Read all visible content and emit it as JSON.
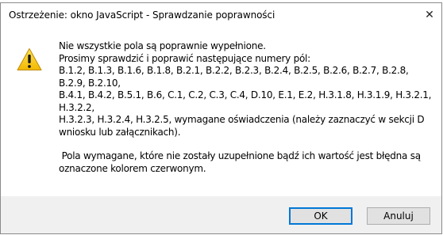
{
  "dialog": {
    "title": "Ostrzeżenie: okno JavaScript - Sprawdzanie poprawności",
    "close_glyph": "✕",
    "icon": "warning-icon",
    "message": {
      "line1": "Nie wszystkie pola są poprawnie wypełnione.",
      "line2": "Prosimy sprawdzić i poprawić następujące numery pól:",
      "line3": "B.1.2, B.1.3, B.1.6, B.1.8, B.2.1, B.2.2, B.2.3, B.2.4, B.2.5, B.2.6, B.2.7, B.2.8, B.2.9, B.2.10,",
      "line4": "B.4.1, B.4.2, B.5.1, B.6, C.1, C.2, C.3, C.4, D.10, E.1, E.2, H.3.1.8, H.3.1.9, H.3.2.1, H.3.2.2,",
      "line5": "H.3.2.3, H.3.2.4, H.3.2.5, wymagane oświadczenia (należy zaznaczyć w sekcji D",
      "line6": "wniosku lub załącznikach).",
      "line7": " Pola wymagane, które nie zostały uzupełnione bądź ich wartość jest błędna są",
      "line8": "oznaczone kolorem czerwonym."
    },
    "buttons": {
      "ok_label": "OK",
      "cancel_label": "Anuluj"
    },
    "colors": {
      "warning_fill": "#fcd116",
      "accent": "#0078d7"
    }
  }
}
